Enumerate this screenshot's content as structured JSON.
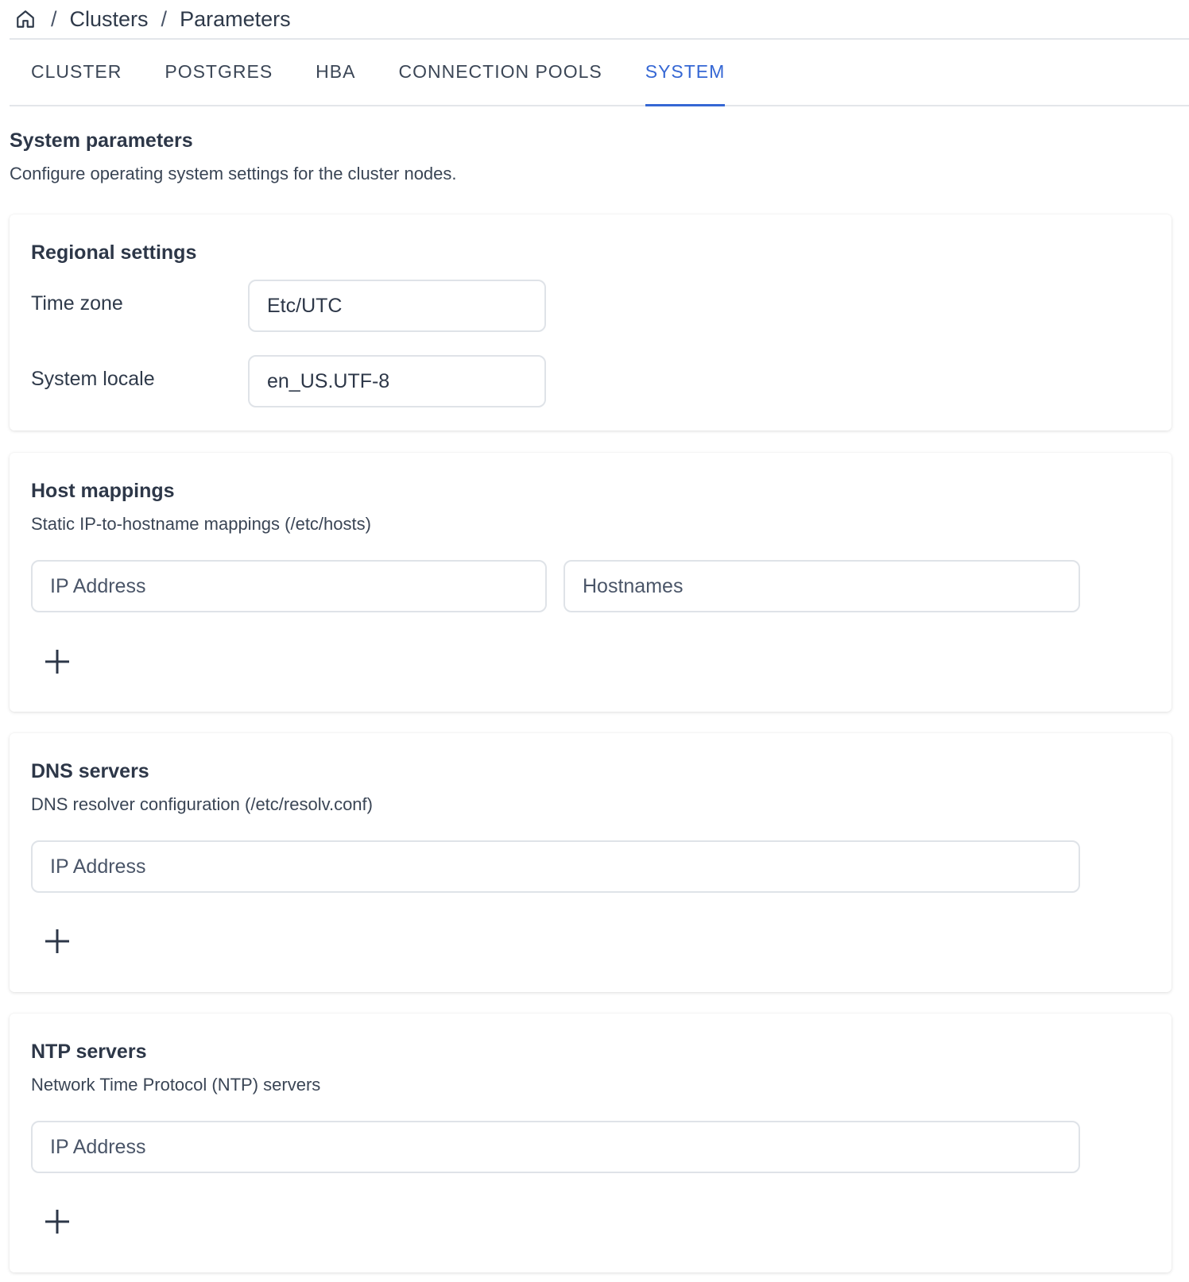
{
  "breadcrumb": {
    "home_icon": "home-icon",
    "separator": "/",
    "items": [
      "Clusters",
      "Parameters"
    ]
  },
  "tabs": [
    {
      "label": "CLUSTER",
      "active": false
    },
    {
      "label": "POSTGRES",
      "active": false
    },
    {
      "label": "HBA",
      "active": false
    },
    {
      "label": "CONNECTION POOLS",
      "active": false
    },
    {
      "label": "SYSTEM",
      "active": true
    }
  ],
  "page": {
    "title": "System parameters",
    "subtitle": "Configure operating system settings for the cluster nodes."
  },
  "regional": {
    "title": "Regional settings",
    "timezone_label": "Time zone",
    "timezone_value": "Etc/UTC",
    "locale_label": "System locale",
    "locale_value": "en_US.UTF-8"
  },
  "hosts": {
    "title": "Host mappings",
    "description": "Static IP-to-hostname mappings (/etc/hosts)",
    "ip_placeholder": "IP Address",
    "hostnames_placeholder": "Hostnames",
    "add_icon": "plus-icon"
  },
  "dns": {
    "title": "DNS servers",
    "description": "DNS resolver configuration (/etc/resolv.conf)",
    "ip_placeholder": "IP Address",
    "add_icon": "plus-icon"
  },
  "ntp": {
    "title": "NTP servers",
    "description": "Network Time Protocol (NTP) servers",
    "ip_placeholder": "IP Address",
    "add_icon": "plus-icon"
  },
  "colors": {
    "accent": "#3567d4",
    "text": "#2d3748",
    "border": "#dfe3e8"
  }
}
